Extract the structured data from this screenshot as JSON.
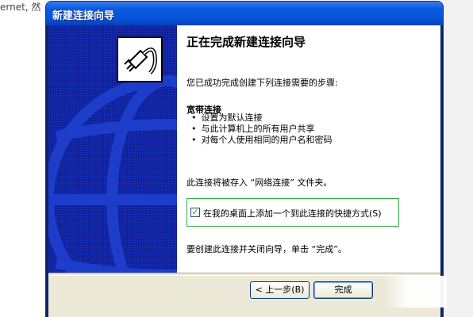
{
  "background": {
    "left_text": "ernet, 然"
  },
  "window": {
    "title": "新建连接向导"
  },
  "page": {
    "heading": "正在完成新建连接向导",
    "intro": "您已成功完成创建下列连接需要的步骤:",
    "connection_name": "宽带连接",
    "steps": [
      "设置为默认连接",
      "与此计算机上的所有用户共享",
      "对每个人使用相同的用户名和密码"
    ],
    "save_location": "此连接将被存入 “网络连接” 文件夹。",
    "shortcut_checkbox": {
      "label": "在我的桌面上添加一个到此连接的快捷方式(S)",
      "checked": true
    },
    "finish_hint": "要创建此连接并关闭向导，单击 “完成”。"
  },
  "buttons": {
    "back": "< 上一步(B)",
    "finish": "完成"
  },
  "colors": {
    "sidepanel": "#0f1f99",
    "titlebar": "#0653dc",
    "checkbox_highlight": "#2ea940"
  }
}
